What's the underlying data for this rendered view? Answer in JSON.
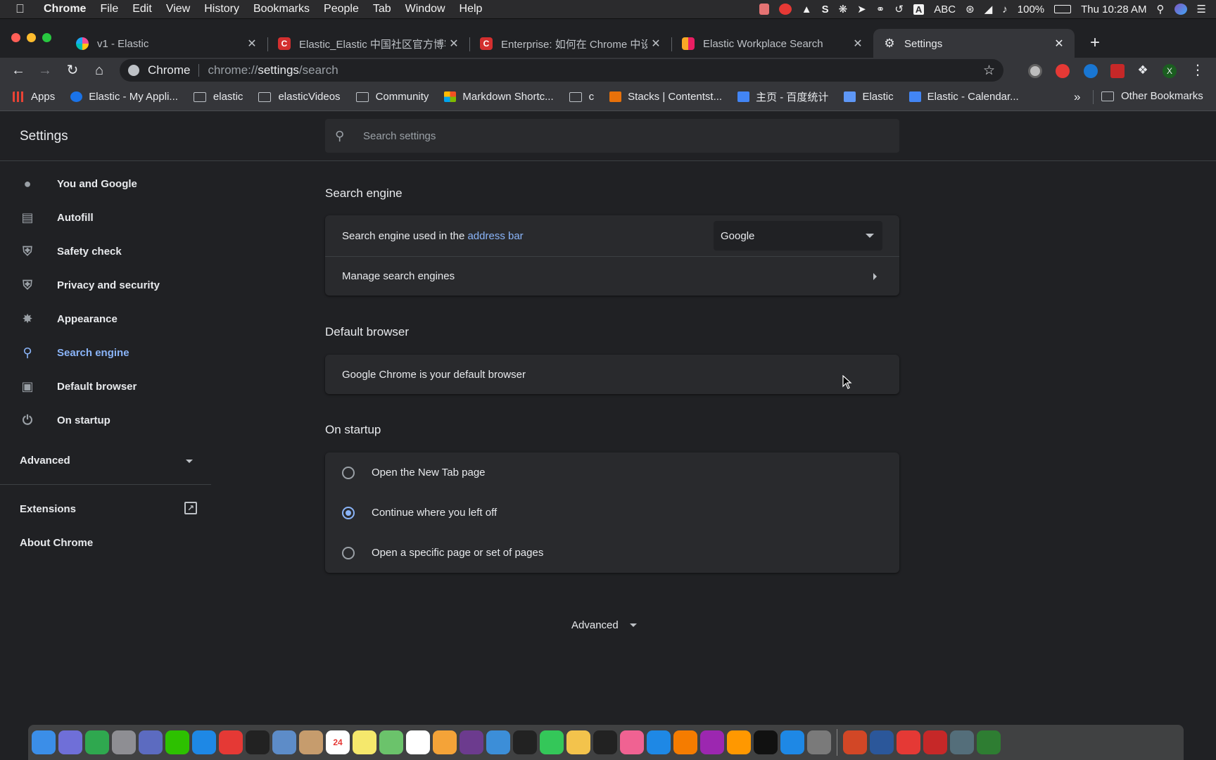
{
  "menubar": {
    "app": "Chrome",
    "items": [
      "File",
      "Edit",
      "View",
      "History",
      "Bookmarks",
      "People",
      "Tab",
      "Window",
      "Help"
    ],
    "input_source": "ABC",
    "battery": "100%",
    "clock": "Thu 10:28 AM"
  },
  "tabs": [
    {
      "title": "v1 - Elastic",
      "favicon_color": "#4db6ac"
    },
    {
      "title": "Elastic_Elastic 中国社区官方博客",
      "favicon_color": "#d32f2f",
      "favicon_letter": "C"
    },
    {
      "title": "Enterprise: 如何在 Chrome 中设",
      "favicon_color": "#d32f2f",
      "favicon_letter": "C"
    },
    {
      "title": "Elastic Workplace Search",
      "favicon_color": "#f9a825"
    },
    {
      "title": "Settings",
      "active": true
    }
  ],
  "omnibox": {
    "chip": "Chrome",
    "url_prefix": "chrome://",
    "url_host": "settings",
    "url_path": "/search"
  },
  "bookmarks": [
    {
      "label": "Apps",
      "kind": "apps",
      "color": "#ea4335"
    },
    {
      "label": "Elastic - My Appli...",
      "kind": "icon",
      "color": "#1a73e8"
    },
    {
      "label": "elastic",
      "kind": "folder"
    },
    {
      "label": "elasticVideos",
      "kind": "folder"
    },
    {
      "label": "Community",
      "kind": "folder"
    },
    {
      "label": "Markdown Shortc...",
      "kind": "icon",
      "color": "#f4b400"
    },
    {
      "label": "c",
      "kind": "folder"
    },
    {
      "label": "Stacks | Contentst...",
      "kind": "icon",
      "color": "#e8710a"
    },
    {
      "label": "主页 - 百度统计",
      "kind": "icon",
      "color": "#4285f4"
    },
    {
      "label": "Elastic",
      "kind": "icon",
      "color": "#5e97f6"
    },
    {
      "label": "Elastic - Calendar...",
      "kind": "icon",
      "color": "#4285f4"
    }
  ],
  "bookmarks_more": "»",
  "other_bookmarks": "Other Bookmarks",
  "settings": {
    "title": "Settings",
    "search_placeholder": "Search settings",
    "nav": [
      {
        "label": "You and Google",
        "icon": "person-icon"
      },
      {
        "label": "Autofill",
        "icon": "clipboard-icon"
      },
      {
        "label": "Safety check",
        "icon": "shield-check-icon"
      },
      {
        "label": "Privacy and security",
        "icon": "shield-icon"
      },
      {
        "label": "Appearance",
        "icon": "palette-icon"
      },
      {
        "label": "Search engine",
        "icon": "search-icon",
        "selected": true
      },
      {
        "label": "Default browser",
        "icon": "browser-icon"
      },
      {
        "label": "On startup",
        "icon": "power-icon"
      }
    ],
    "advanced_label": "Advanced",
    "extensions_label": "Extensions",
    "about_label": "About Chrome"
  },
  "search_engine": {
    "section_title": "Search engine",
    "used_in_prefix": "Search engine used in the ",
    "used_in_link": "address bar",
    "selected": "Google",
    "manage_label": "Manage search engines"
  },
  "default_browser": {
    "section_title": "Default browser",
    "status": "Google Chrome is your default browser"
  },
  "on_startup": {
    "section_title": "On startup",
    "options": [
      {
        "label": "Open the New Tab page",
        "checked": false
      },
      {
        "label": "Continue where you left off",
        "checked": true
      },
      {
        "label": "Open a specific page or set of pages",
        "checked": false
      }
    ]
  },
  "advanced_bottom": "Advanced",
  "dock": {
    "colors": [
      "#3b8ee8",
      "#6f6fd8",
      "#2fa84f",
      "#8e8e93",
      "#5c6bc0",
      "#2dc100",
      "#1e88e5",
      "#e53935",
      "#222222",
      "#5d8cc8",
      "#c69c6d",
      "#ffffff",
      "#f5e86c",
      "#6bc36b",
      "#ffffff",
      "#f4a338",
      "#6c3b8e",
      "#3c8ed8",
      "#222222",
      "#34c759",
      "#f3c34c",
      "#222222",
      "#f06292",
      "#1e88e5",
      "#f57c00",
      "#9c27b0",
      "#ff9800",
      "#111111",
      "#1e88e5",
      "#7a7a7a",
      "#d24726",
      "#2b579a",
      "#e53935",
      "#c62828",
      "#546e7a",
      "#2e7d32"
    ],
    "calendar_day": "24"
  }
}
